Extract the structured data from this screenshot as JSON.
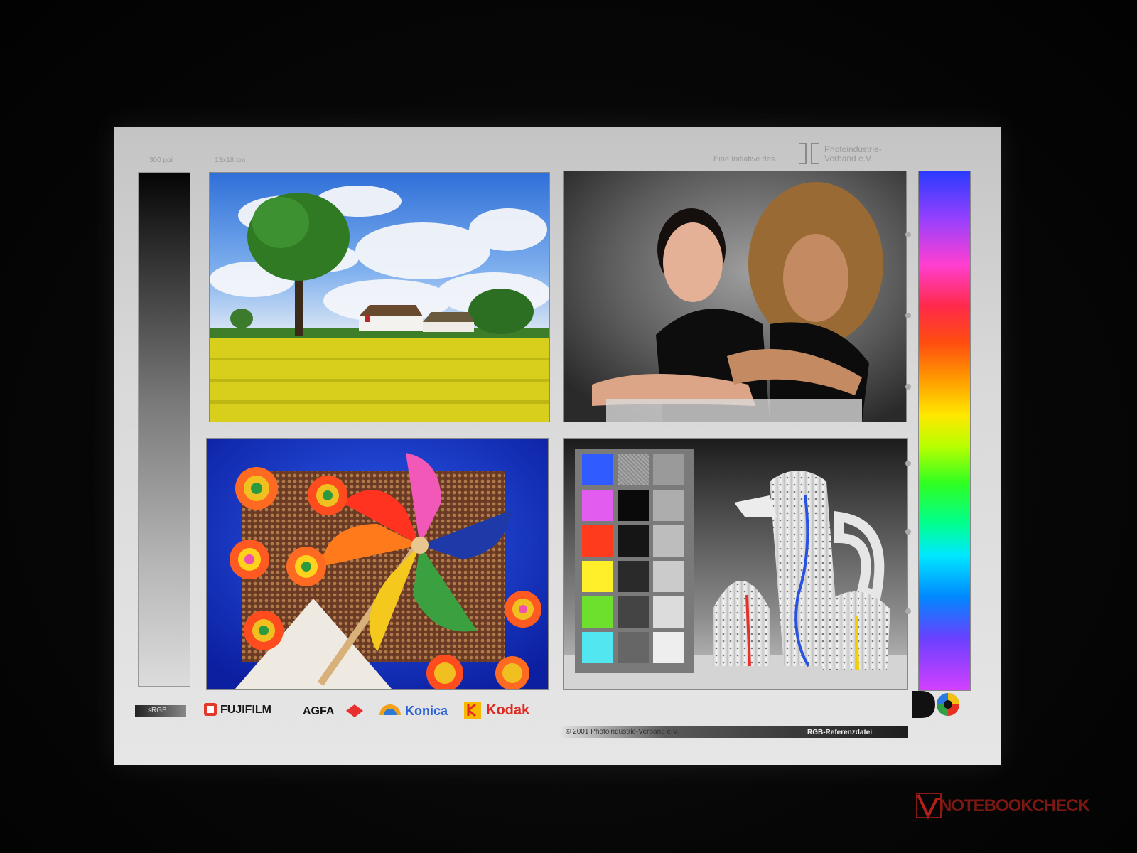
{
  "header": {
    "ppi": "300 ppi",
    "size": "13x18 cm",
    "initiative": "Eine Initiative des",
    "org_line1": "Photoindustrie-",
    "org_line2": "Verband e.V."
  },
  "footer": {
    "colorspace": "sRGB",
    "brands": [
      "FUJIFILM",
      "AGFA",
      "Konica",
      "Kodak"
    ],
    "copyright": "© 2001  Photoindustrie-Verband e.V.",
    "reference": "RGB-Referenzdatei"
  },
  "watermark": "NOTEBOOKCHECK",
  "panels": [
    "landscape-photo",
    "portrait-photo",
    "pinwheel-photo",
    "ceramics-colorchart-photo"
  ],
  "color_patches": [
    "#2f5bff",
    "#e25cf0",
    "#ff3b1e",
    "#ffee2a",
    "#6de02e",
    "#52e6f0"
  ]
}
